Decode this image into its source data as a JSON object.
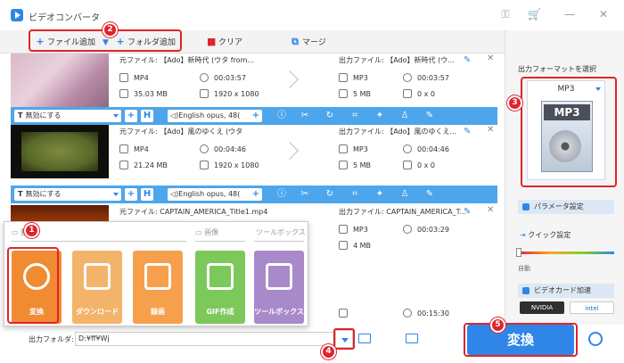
{
  "app": {
    "title": "ビデオコンバータ",
    "colors": {
      "accent": "#2f86e8",
      "highlight": "#e0242b"
    }
  },
  "toolbar": {
    "add_file": "ファイル追加",
    "add_folder": "フォルダ追加",
    "clear": "クリア",
    "merge": "マージ"
  },
  "rows": [
    {
      "source": "元ファイル: 【Ado】新時代 (ウタ from...",
      "src_format": "MP4",
      "src_duration": "00:03:57",
      "src_size": "35.03 MB",
      "src_res": "1920 x 1080",
      "output": "出力ファイル: 【Ado】新時代 (ウ...",
      "out_format": "MP3",
      "out_duration": "00:03:57",
      "out_size": "5 MB",
      "out_res": "0 x 0"
    },
    {
      "source": "元ファイル: 【Ado】風のゆくえ (ウタ",
      "src_format": "MP4",
      "src_duration": "00:04:46",
      "src_size": "21.24 MB",
      "src_res": "1920 x 1080",
      "output": "出力ファイル: 【Ado】風のゆくえ...",
      "out_format": "MP3",
      "out_duration": "00:04:46",
      "out_size": "5 MB",
      "out_res": "0 x 0"
    },
    {
      "source": "元ファイル: CAPTAIN_AMERICA_Title1.mp4",
      "output": "出力ファイル: CAPTAIN_AMERICA_T...",
      "out_format": "MP3",
      "out_duration": "00:03:29",
      "out_size": "4 MB"
    }
  ],
  "option_bar": {
    "subtitle": "無効にする",
    "audio": "English opus, 48("
  },
  "row4": {
    "out_duration": "00:15:30"
  },
  "popup": {
    "section_video": "動画",
    "section_image": "画像",
    "section_tools": "ツールボックス",
    "tiles": [
      "変換",
      "ダウンロード",
      "録画",
      "GIF作成",
      "ツールボックス"
    ]
  },
  "right_panel": {
    "format_label": "出力フォーマットを選択",
    "format_name": "MP3",
    "format_art_text": "MP3",
    "param_button": "パラメータ設定",
    "quick_label": "クイック設定",
    "slider_label": "自動",
    "gpu_button": "ビデオカード加速",
    "gpu_nvidia": "NVIDIA",
    "gpu_intel": "intel"
  },
  "bottom": {
    "output_folder_label": "出力フォルダ:",
    "output_folder_value": "D:¥ff¥Wj",
    "convert_button": "変換"
  },
  "badges": [
    "1",
    "2",
    "3",
    "4",
    "5"
  ]
}
